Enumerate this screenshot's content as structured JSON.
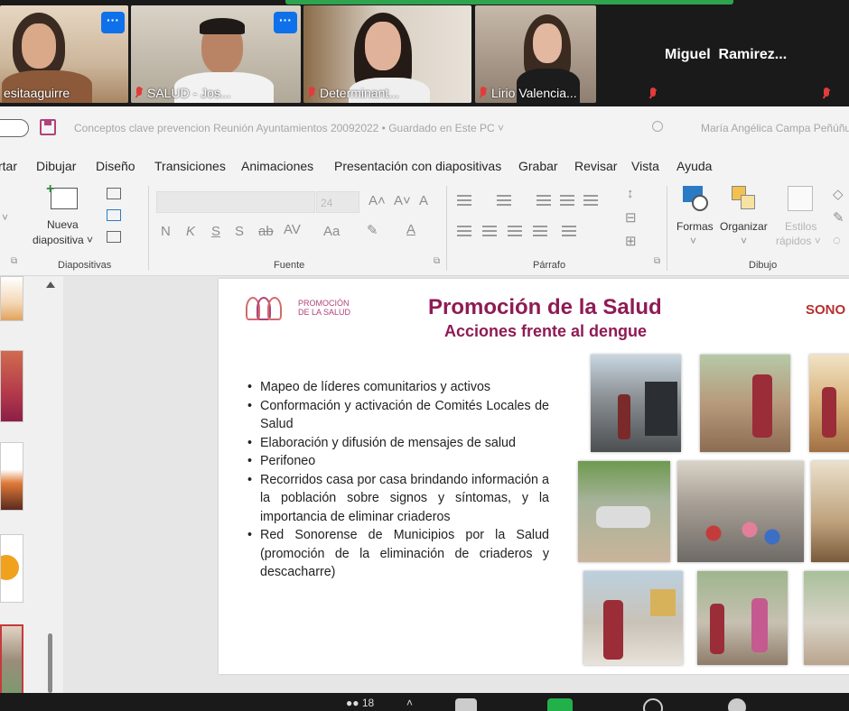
{
  "zoom": {
    "participants": [
      {
        "name": "esitaaguirre",
        "muted": false,
        "has_video": true
      },
      {
        "name": "SALUD - Jos...",
        "muted": true,
        "has_video": true
      },
      {
        "name": "Determinant...",
        "muted": true,
        "has_video": true
      },
      {
        "name": "Lirio Valencia...",
        "muted": true,
        "has_video": true
      },
      {
        "name": "Miguel  Ramirez...",
        "muted": true,
        "has_video": false
      },
      {
        "name": "",
        "muted": true,
        "has_video": false
      }
    ],
    "more_label": "···",
    "participants_count": "18"
  },
  "ppt": {
    "doc_title": "Conceptos clave prevencion Reunión Ayuntamientos 20092022 • Guardado en Este PC ˅",
    "user_name": "María Angélica Campa Peñúñuri",
    "tabs": [
      "rtar",
      "Dibujar",
      "Diseño",
      "Transiciones",
      "Animaciones",
      "Presentación con diapositivas",
      "Grabar",
      "Revisar",
      "Vista",
      "Ayuda"
    ],
    "ribbon": {
      "new_slide_line1": "Nueva",
      "new_slide_line2": "diapositiva ˅",
      "group_slides": "Diapositivas",
      "group_font": "Fuente",
      "group_paragraph": "Párrafo",
      "group_drawing": "Dibujo",
      "font_size": "24",
      "shapes_label": "Formas",
      "arrange_label": "Organizar",
      "quick_styles_line1": "Estilos",
      "quick_styles_line2": "rápidos ˅",
      "font_buttons": [
        "N",
        "K",
        "S",
        "S",
        "ab",
        "AV",
        "Aa"
      ]
    }
  },
  "slide": {
    "title": "Promoción de la Salud",
    "subtitle": "Acciones frente al dengue",
    "logo_text": "PROMOCIÓN\nDE LA SALUD",
    "sonora_text": "SONO",
    "bullets": [
      "Mapeo de líderes comunitarios y activos",
      "Conformación y activación de Comités Locales de Salud",
      "Elaboración y difusión de mensajes de salud",
      "Perifoneo",
      "Recorridos casa por casa brindando información a la población sobre signos y síntomas, y la importancia de eliminar criaderos",
      "Red Sonorense de Municipios por la Salud (promoción de la eliminación de criaderos y descacharre)"
    ]
  },
  "colors": {
    "accent_magenta": "#8e1b54",
    "zoom_green": "#2ea44f",
    "zoom_blue": "#0e71eb",
    "muted_red": "#e23b3b"
  }
}
